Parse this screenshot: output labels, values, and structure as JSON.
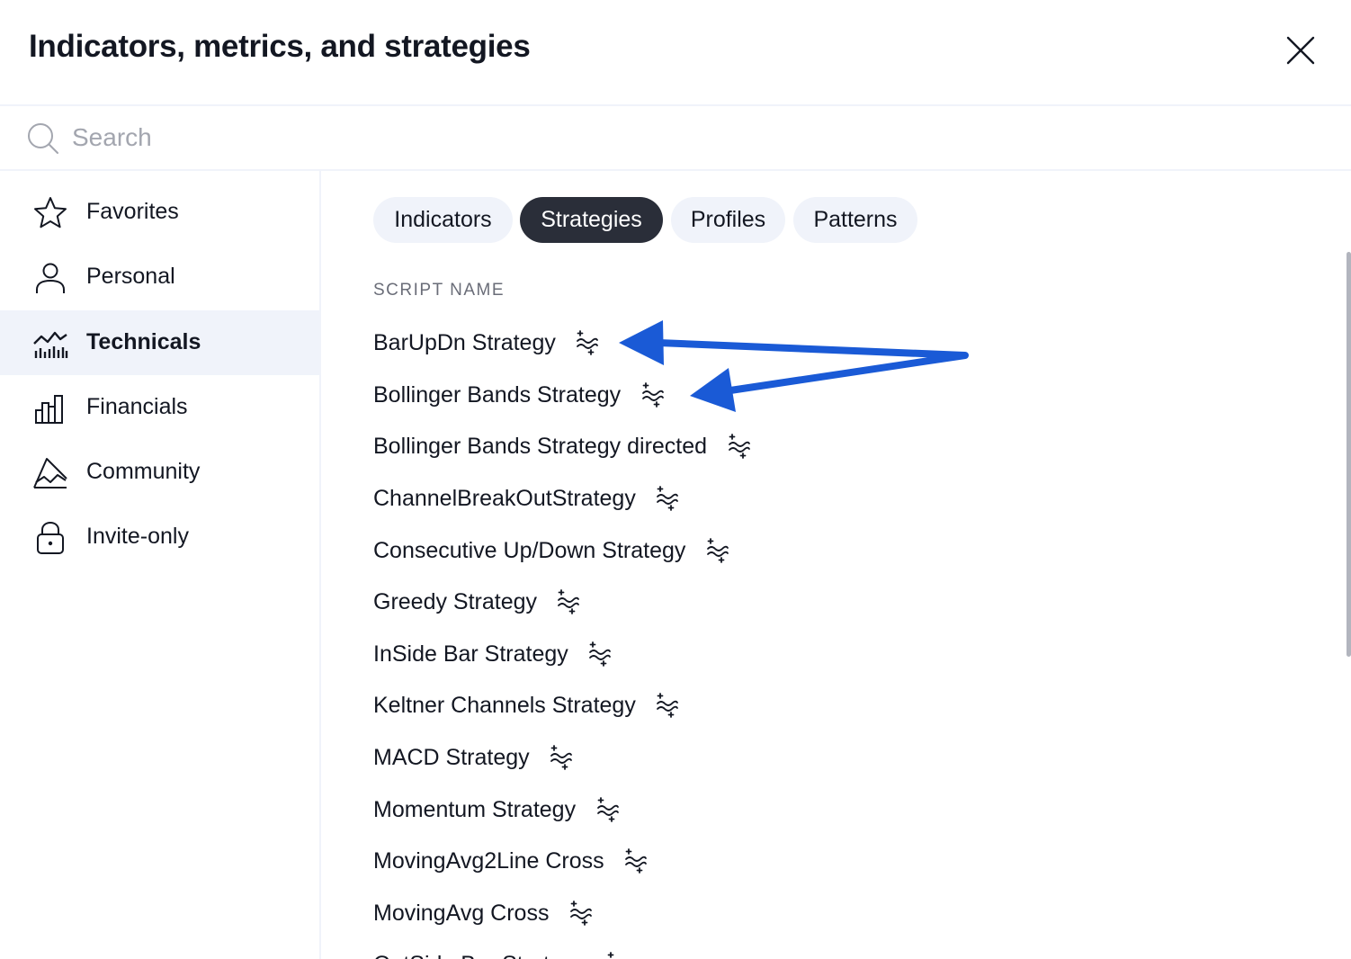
{
  "dialog": {
    "title": "Indicators, metrics, and strategies",
    "close_icon": "close-icon"
  },
  "search": {
    "placeholder": "Search",
    "value": "",
    "icon": "search-icon"
  },
  "sidebar": {
    "items": [
      {
        "label": "Favorites",
        "icon": "star-icon",
        "active": false
      },
      {
        "label": "Personal",
        "icon": "user-icon",
        "active": false
      },
      {
        "label": "Technicals",
        "icon": "chart-icon",
        "active": true
      },
      {
        "label": "Financials",
        "icon": "bar-chart-icon",
        "active": false
      },
      {
        "label": "Community",
        "icon": "community-icon",
        "active": false
      },
      {
        "label": "Invite-only",
        "icon": "lock-icon",
        "active": false
      }
    ]
  },
  "tabs": [
    {
      "label": "Indicators",
      "active": false
    },
    {
      "label": "Strategies",
      "active": true
    },
    {
      "label": "Profiles",
      "active": false
    },
    {
      "label": "Patterns",
      "active": false
    }
  ],
  "list": {
    "column_header": "SCRIPT NAME",
    "item_icon": "strategy-icon",
    "items": [
      {
        "name": "BarUpDn Strategy"
      },
      {
        "name": "Bollinger Bands Strategy"
      },
      {
        "name": "Bollinger Bands Strategy directed"
      },
      {
        "name": "ChannelBreakOutStrategy"
      },
      {
        "name": "Consecutive Up/Down Strategy"
      },
      {
        "name": "Greedy Strategy"
      },
      {
        "name": "InSide Bar Strategy"
      },
      {
        "name": "Keltner Channels Strategy"
      },
      {
        "name": "MACD Strategy"
      },
      {
        "name": "Momentum Strategy"
      },
      {
        "name": "MovingAvg2Line Cross"
      },
      {
        "name": "MovingAvg Cross"
      },
      {
        "name": "OutSide Bar Strategy"
      }
    ]
  },
  "annotation": {
    "color": "#1a5ad6",
    "targets": [
      "BarUpDn Strategy",
      "Bollinger Bands Strategy"
    ]
  },
  "colors": {
    "active_tab_bg": "#2a2e39",
    "tab_bg": "#f0f3fa",
    "active_sidebar_bg": "#f0f3fa",
    "text": "#131722",
    "muted_text": "#6a6d78"
  }
}
